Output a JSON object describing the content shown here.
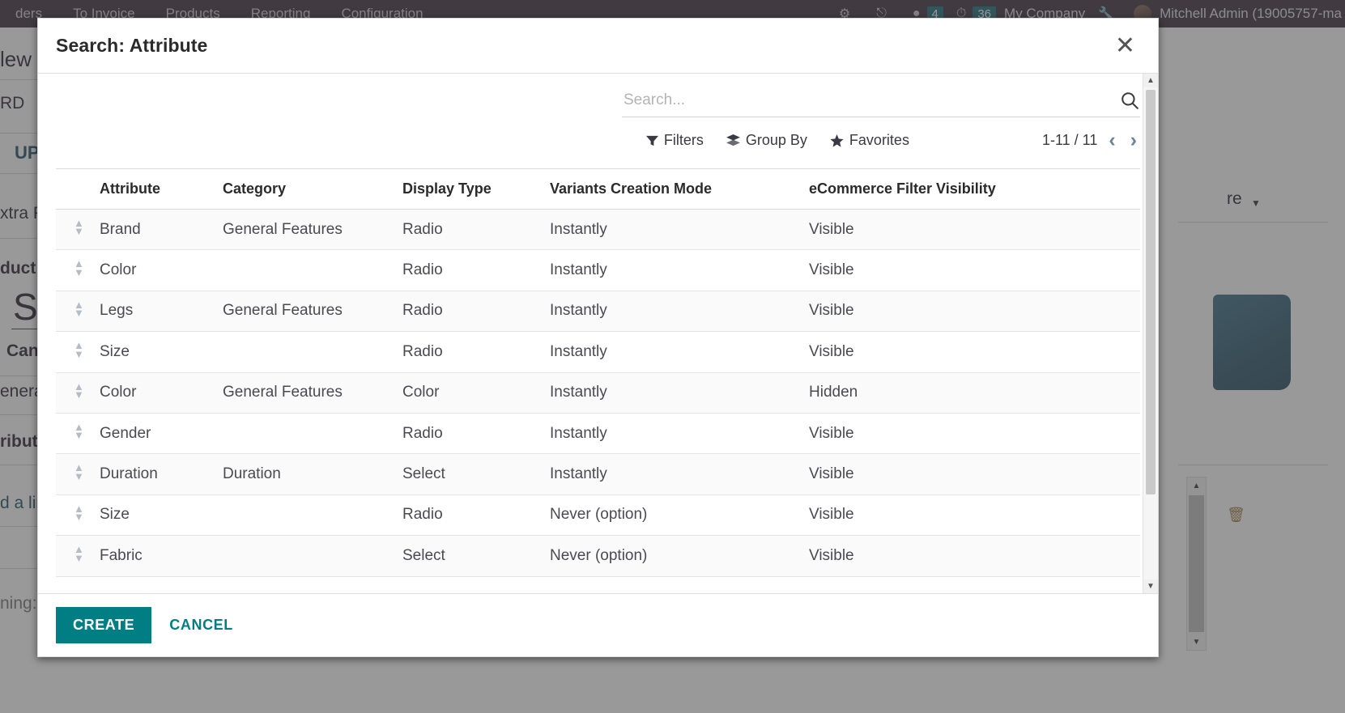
{
  "topbar": {
    "menu_items": [
      "ders",
      "To Invoice",
      "Products",
      "Reporting",
      "Configuration"
    ],
    "icons": [
      {
        "name": "bug-icon",
        "glyph": "⚙"
      },
      {
        "name": "headset-icon",
        "glyph": "⌒"
      },
      {
        "name": "messages-icon",
        "glyph": "●",
        "badge": "4"
      },
      {
        "name": "activities-icon",
        "glyph": "◔",
        "badge": "36"
      }
    ],
    "company": "My Company",
    "settings_icon": "wrench-icon",
    "user": "Mitchell Admin (19005757-ma",
    "accent_bar": "#3c2f3c",
    "badge_color": "#1b6a7a"
  },
  "background": {
    "left_fragments": [
      "lew",
      "RD",
      "UP",
      "xtra P",
      "duct N",
      "S",
      "Can",
      "eneral",
      "ribute",
      "d a line",
      "ning: a"
    ],
    "right_fragments": [
      "re"
    ]
  },
  "modal": {
    "title": "Search: Attribute",
    "close_label": "✕",
    "search": {
      "value": "",
      "placeholder": "Search...",
      "icon": "search-icon"
    },
    "controls": [
      {
        "name": "filters",
        "label": "Filters",
        "icon": "funnel-icon"
      },
      {
        "name": "group-by",
        "label": "Group By",
        "icon": "layers-icon"
      },
      {
        "name": "favorites",
        "label": "Favorites",
        "icon": "star-icon"
      }
    ],
    "pager": {
      "range": "1-11 / 11",
      "prev_icon": "chevron-left-icon",
      "next_icon": "chevron-right-icon"
    },
    "table": {
      "columns": [
        "Attribute",
        "Category",
        "Display Type",
        "Variants Creation Mode",
        "eCommerce Filter Visibility"
      ],
      "rows": [
        {
          "attribute": "Brand",
          "category": "General Features",
          "display_type": "Radio",
          "variants_creation_mode": "Instantly",
          "ecommerce_filter_visibility": "Visible"
        },
        {
          "attribute": "Color",
          "category": "",
          "display_type": "Radio",
          "variants_creation_mode": "Instantly",
          "ecommerce_filter_visibility": "Visible"
        },
        {
          "attribute": "Legs",
          "category": "General Features",
          "display_type": "Radio",
          "variants_creation_mode": "Instantly",
          "ecommerce_filter_visibility": "Visible"
        },
        {
          "attribute": "Size",
          "category": "",
          "display_type": "Radio",
          "variants_creation_mode": "Instantly",
          "ecommerce_filter_visibility": "Visible"
        },
        {
          "attribute": "Color",
          "category": "General Features",
          "display_type": "Color",
          "variants_creation_mode": "Instantly",
          "ecommerce_filter_visibility": "Hidden"
        },
        {
          "attribute": "Gender",
          "category": "",
          "display_type": "Radio",
          "variants_creation_mode": "Instantly",
          "ecommerce_filter_visibility": "Visible"
        },
        {
          "attribute": "Duration",
          "category": "Duration",
          "display_type": "Select",
          "variants_creation_mode": "Instantly",
          "ecommerce_filter_visibility": "Visible"
        },
        {
          "attribute": "Size",
          "category": "",
          "display_type": "Radio",
          "variants_creation_mode": "Never (option)",
          "ecommerce_filter_visibility": "Visible"
        },
        {
          "attribute": "Fabric",
          "category": "",
          "display_type": "Select",
          "variants_creation_mode": "Never (option)",
          "ecommerce_filter_visibility": "Visible"
        }
      ]
    },
    "footer": {
      "create_label": "CREATE",
      "cancel_label": "CANCEL",
      "create_color": "#017e84"
    }
  }
}
